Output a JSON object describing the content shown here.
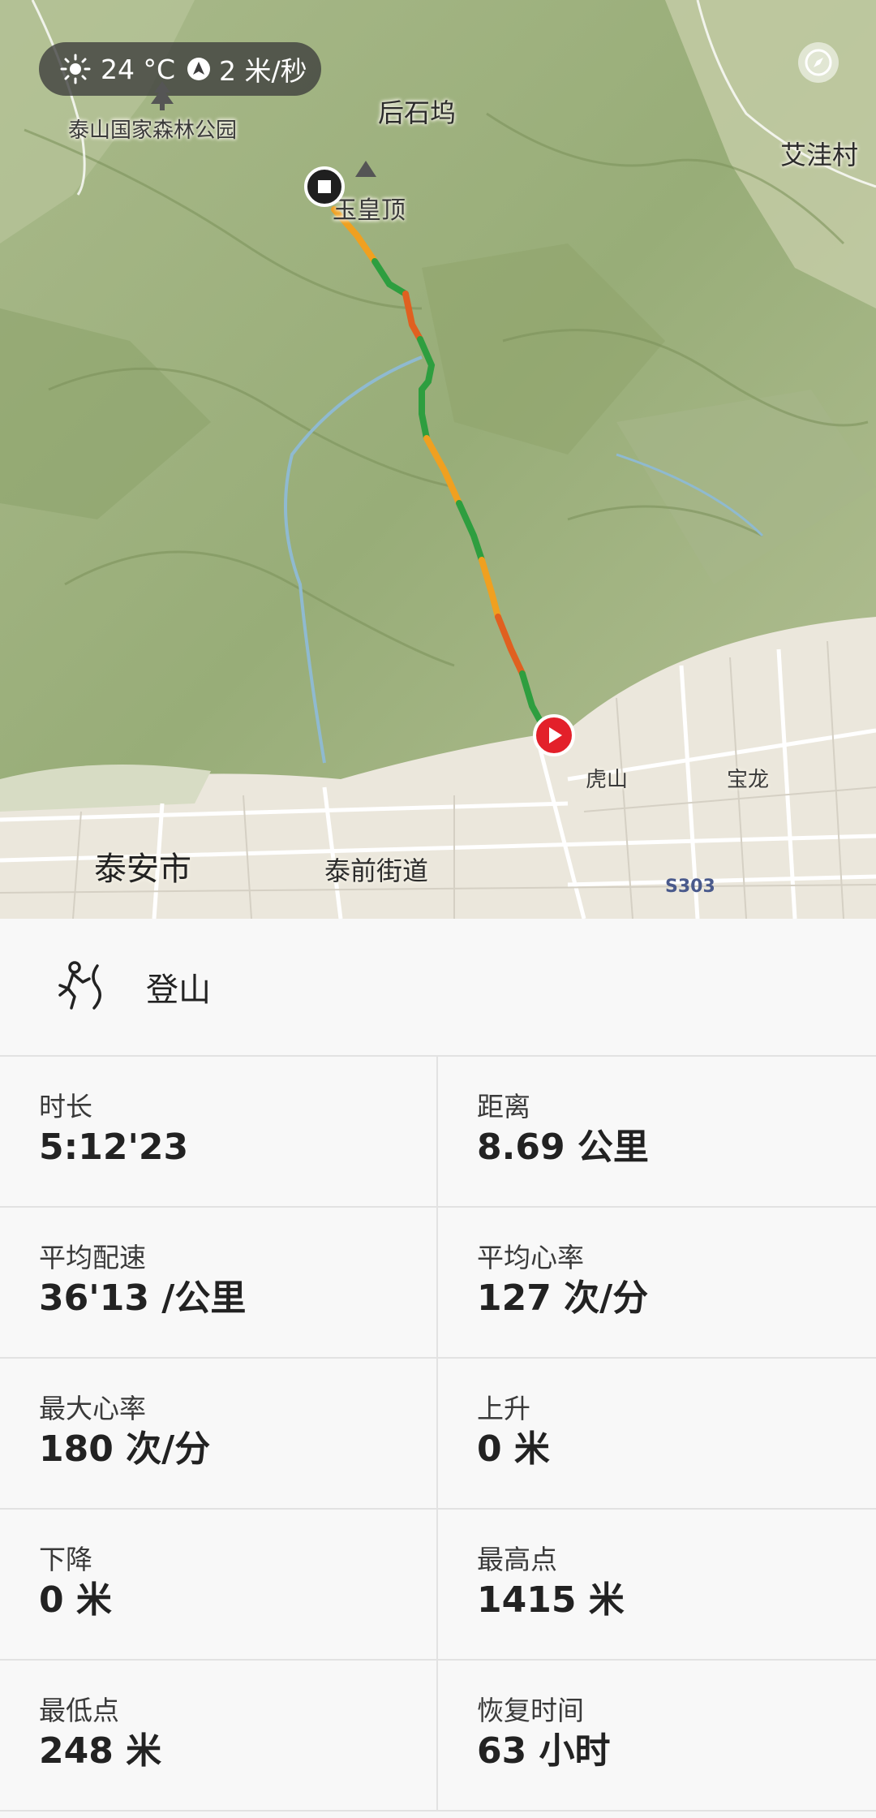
{
  "weather": {
    "icon": "sun-icon",
    "temperature": "24 °C",
    "wind_icon": "wind-direction-icon",
    "wind_speed": "2 米/秒"
  },
  "map": {
    "labels": {
      "park": "泰山国家森林公园",
      "houshiwu": "后石坞",
      "aiwa": "艾洼村",
      "summit": "玉皇顶",
      "hushan": "虎山",
      "baolong": "宝龙",
      "taian": "泰安市",
      "taiqian": "泰前街道",
      "road": "S303"
    },
    "colors": {
      "track_green": "#2e9e3f",
      "track_orange": "#f0a020",
      "track_red": "#e06020",
      "start": "#e3202a"
    }
  },
  "activity": {
    "icon": "hiking-icon",
    "label": "登山"
  },
  "stats": [
    {
      "label": "时长",
      "value": "5:12'23"
    },
    {
      "label": "距离",
      "value": "8.69 公里"
    },
    {
      "label": "平均配速",
      "value": "36'13 /公里"
    },
    {
      "label": "平均心率",
      "value": "127 次/分"
    },
    {
      "label": "最大心率",
      "value": "180 次/分"
    },
    {
      "label": "上升",
      "value": "0 米"
    },
    {
      "label": "下降",
      "value": "0 米"
    },
    {
      "label": "最高点",
      "value": "1415 米"
    },
    {
      "label": "最低点",
      "value": "248 米"
    },
    {
      "label": "恢复时间",
      "value": "63 小时"
    }
  ]
}
